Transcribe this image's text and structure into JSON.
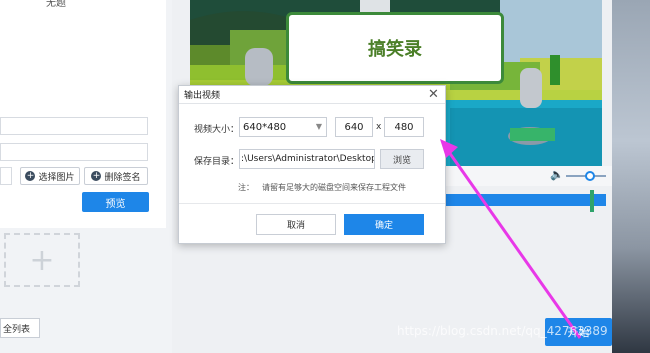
{
  "left_panel": {
    "top_clipped_text": "无题",
    "select_image_label": "选择图片",
    "delete_signature_label": "删除签名",
    "preview_label": "预览",
    "add_tile_icon": "plus-icon",
    "list_button_label": "全列表"
  },
  "video": {
    "title_card_text": "搞笑录",
    "start_label": "开始"
  },
  "dialog": {
    "title": "输出视频",
    "close_icon": "close-icon",
    "video_size_label": "视频大小：",
    "video_size_value": "640*480",
    "width_value": "640",
    "x_separator": "x",
    "height_value": "480",
    "save_dir_label": "保存目录：",
    "save_dir_value": ":\\Users\\Administrator\\Desktop",
    "browse_label": "浏览",
    "note_label": "注：",
    "note_text": "请留有足够大的磁盘空间来保存工程文件",
    "cancel_label": "取消",
    "ok_label": "确定"
  },
  "watermark": "https://blog.csdn.net/qq_42763389",
  "colors": {
    "accent": "#1e86e8",
    "annotation_arrow": "#e838e8"
  }
}
